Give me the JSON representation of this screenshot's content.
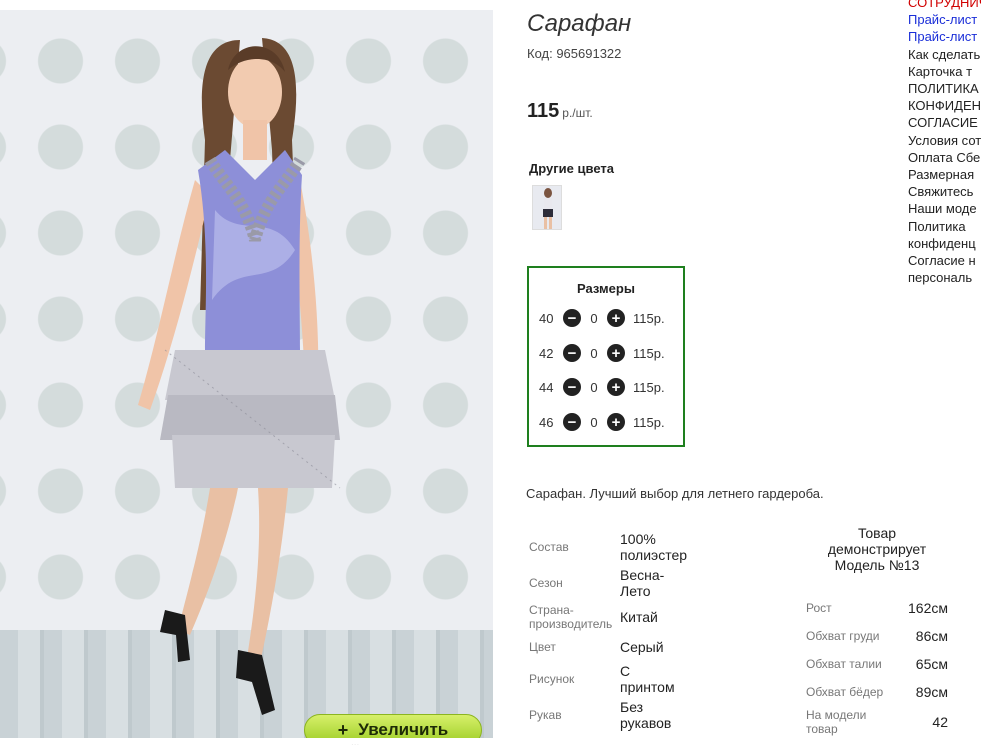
{
  "product": {
    "title": "Сарафан",
    "code": "Код: 965691322",
    "price": "115",
    "price_unit": "р./шт.",
    "other_colors_label": "Другие цвета",
    "zoom_label": "Увеличить",
    "zoom_icon": "+",
    "description": "Сарафан. Лучший выбор для летнего гардероба."
  },
  "sizes": {
    "title": "Размеры",
    "rows": [
      {
        "size": "40",
        "qty": "0",
        "price": "115р."
      },
      {
        "size": "42",
        "qty": "0",
        "price": "115р."
      },
      {
        "size": "44",
        "qty": "0",
        "price": "115р."
      },
      {
        "size": "46",
        "qty": "0",
        "price": "115р."
      }
    ]
  },
  "specs": [
    {
      "label": "Состав",
      "value": "100% полиэстер"
    },
    {
      "label": "Сезон",
      "value": "Весна-Лето"
    },
    {
      "label": "Страна-производитель",
      "value": "Китай"
    },
    {
      "label": "Цвет",
      "value": "Серый"
    },
    {
      "label": "Рисунок",
      "value": "С принтом"
    },
    {
      "label": "Рукав",
      "value": "Без рукавов"
    }
  ],
  "model": {
    "title": "Товар демонстрирует Модель №13",
    "rows": [
      {
        "label": "Рост",
        "value": "162см"
      },
      {
        "label": "Обхват груди",
        "value": "86см"
      },
      {
        "label": "Обхват талии",
        "value": "65см"
      },
      {
        "label": "Обхват бёдер",
        "value": "89см"
      },
      {
        "label": "На модели товар",
        "value": "42"
      }
    ]
  },
  "sidebar": {
    "links": [
      {
        "text": "СОТРУДНИЧ",
        "color": "red"
      },
      {
        "text": "Прайс-лист",
        "color": "blue"
      },
      {
        "text": "Прайс-лист",
        "color": "blue"
      },
      {
        "text": "Как сделать",
        "color": "black"
      },
      {
        "text": "Карточка т",
        "color": "black"
      },
      {
        "text": "ПОЛИТИКА",
        "color": "black"
      },
      {
        "text": "КОНФИДЕН",
        "color": "black"
      },
      {
        "text": "СОГЛАСИЕ",
        "color": "black"
      },
      {
        "text": "Условия сот",
        "color": "black"
      },
      {
        "text": "Оплата Сбе",
        "color": "black"
      },
      {
        "text": "Размерная",
        "color": "black"
      },
      {
        "text": "Свяжитесь",
        "color": "black"
      },
      {
        "text": "Наши моде",
        "color": "black"
      },
      {
        "text": "Политика",
        "color": "black"
      },
      {
        "text": "конфиденц",
        "color": "black"
      },
      {
        "text": "Согласие н",
        "color": "black"
      },
      {
        "text": "персональ",
        "color": "black"
      }
    ]
  },
  "footer": {
    "dots": "..."
  },
  "colors": {
    "accent_green": "#1e7f1e",
    "zoom_button": "#b8de3c",
    "sidebar_red": "#d00000",
    "sidebar_blue": "#1a2ed8"
  }
}
